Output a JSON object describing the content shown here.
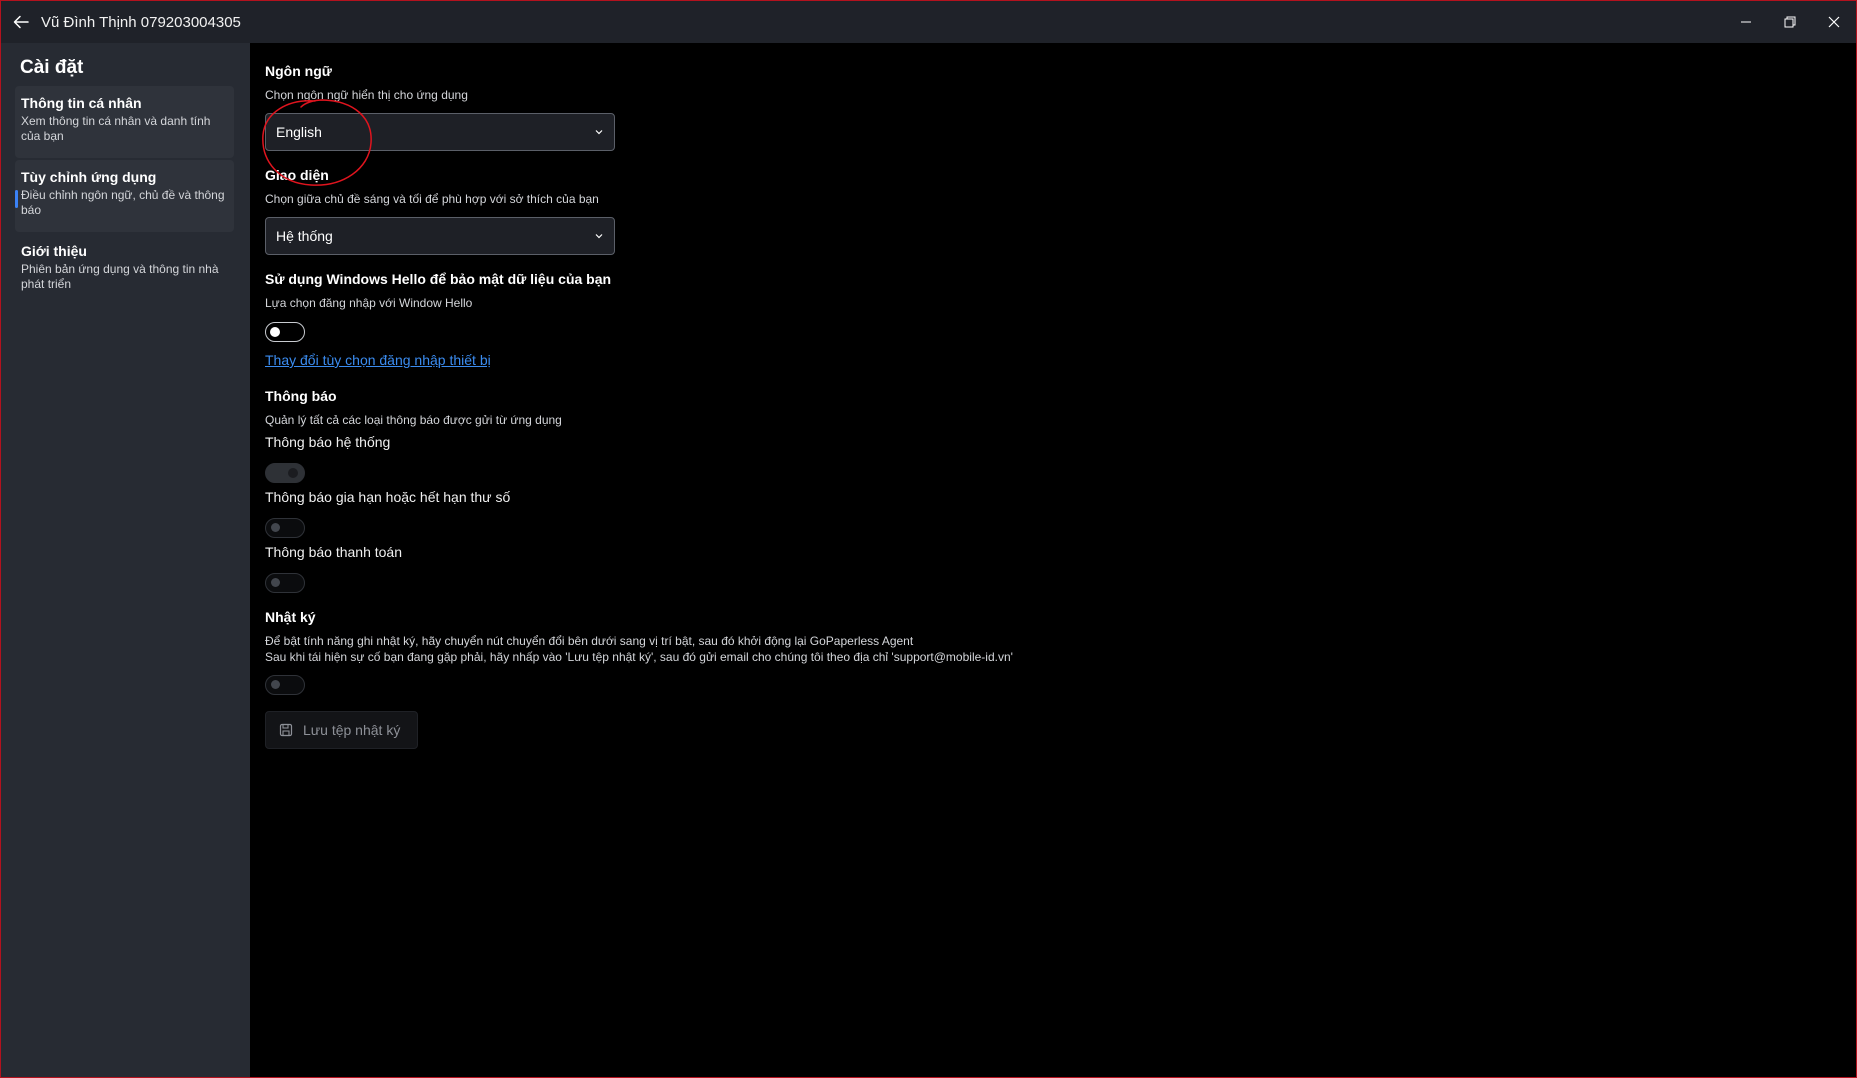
{
  "titlebar": {
    "title": "Vũ Đình Thịnh 079203004305"
  },
  "sidebar": {
    "title": "Cài đặt",
    "items": [
      {
        "label": "Thông tin cá nhân",
        "desc": "Xem thông tin cá nhân và danh tính của bạn"
      },
      {
        "label": "Tùy chỉnh ứng dụng",
        "desc": "Điều chỉnh ngôn ngữ, chủ đề và thông báo"
      },
      {
        "label": "Giới thiệu",
        "desc": "Phiên bản ứng dụng và thông tin nhà phát triển"
      }
    ]
  },
  "language": {
    "title": "Ngôn ngữ",
    "desc": "Chọn ngôn ngữ hiển thị cho ứng dụng",
    "value": "English"
  },
  "theme": {
    "title": "Giao diện",
    "desc": "Chọn giữa chủ đề sáng và tối để phù hợp với sở thích của bạn",
    "value": "Hệ thống"
  },
  "hello": {
    "title": "Sử dụng Windows Hello để bảo mật dữ liệu của bạn",
    "desc": "Lựa chọn đăng nhập với Window Hello",
    "link": "Thay đổi tùy chọn đăng nhập thiết bị"
  },
  "notifications": {
    "title": "Thông báo",
    "desc": "Quản lý tất cả các loại thông báo được gửi từ ứng dụng",
    "items": [
      {
        "label": "Thông báo hệ thống"
      },
      {
        "label": "Thông báo gia hạn hoặc hết hạn thư số"
      },
      {
        "label": "Thông báo thanh toán"
      }
    ]
  },
  "log": {
    "title": "Nhật ký",
    "desc1": "Để bật tính năng ghi nhật ký, hãy chuyển nút chuyển đổi bên dưới sang vị trí bật, sau đó khởi động lại GoPaperless Agent",
    "desc2": "Sau khi tái hiện sự cố bạn đang gặp phải, hãy nhấp vào 'Lưu tệp nhật ký', sau đó gửi email cho chúng tôi theo địa chỉ 'support@mobile-id.vn'",
    "save_label": "Lưu tệp nhật ký"
  },
  "colors": {
    "frame_border": "#b3121e",
    "sidebar_bg": "#272b33",
    "accent": "#3b82f6",
    "link": "#3b8cf0",
    "annotation": "#e0141e"
  }
}
